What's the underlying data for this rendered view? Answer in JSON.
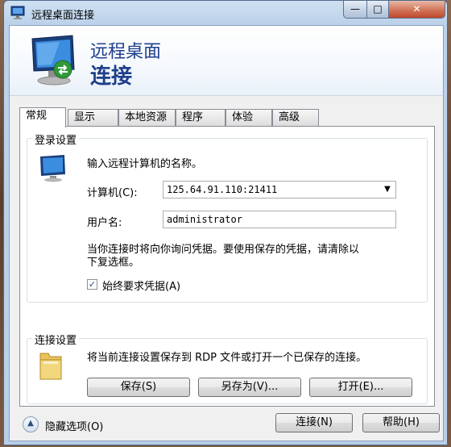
{
  "window": {
    "title": "远程桌面连接",
    "controls": {
      "minimize": "—",
      "maximize": "□",
      "close": "✕"
    }
  },
  "banner": {
    "line1": "远程桌面",
    "line2": "连接"
  },
  "tabs": [
    {
      "label": "常规",
      "active": true
    },
    {
      "label": "显示",
      "active": false
    },
    {
      "label": "本地资源",
      "active": false
    },
    {
      "label": "程序",
      "active": false
    },
    {
      "label": "体验",
      "active": false
    },
    {
      "label": "高级",
      "active": false
    }
  ],
  "login": {
    "group_title": "登录设置",
    "instruction": "输入远程计算机的名称。",
    "computer_label": "计算机(C):",
    "computer_value": "125.64.91.110:21411",
    "username_label": "用户名:",
    "username_value": "administrator",
    "info_line1": "当你连接时将向你询问凭据。要使用保存的凭据，请清除以",
    "info_line2": "下复选框。",
    "always_ask_label": "始终要求凭据(A)",
    "always_ask_checked": true,
    "check_glyph": "✓"
  },
  "connection": {
    "group_title": "连接设置",
    "description": "将当前连接设置保存到 RDP 文件或打开一个已保存的连接。",
    "save_label": "保存(S)",
    "save_as_label": "另存为(V)...",
    "open_label": "打开(E)..."
  },
  "footer": {
    "hide_options_label": "隐藏选项(O)",
    "expand_glyph": "▲",
    "connect_label": "连接(N)",
    "help_label": "帮助(H)"
  },
  "colors": {
    "banner_text": "#1e3f8a",
    "window_frame": "#bcd2ea",
    "close_button": "#c0472b"
  },
  "icons": [
    "remote-desktop-icon",
    "monitor-icon",
    "folder-icon",
    "chevron-up-icon",
    "dropdown-arrow-icon",
    "checkmark-icon"
  ]
}
